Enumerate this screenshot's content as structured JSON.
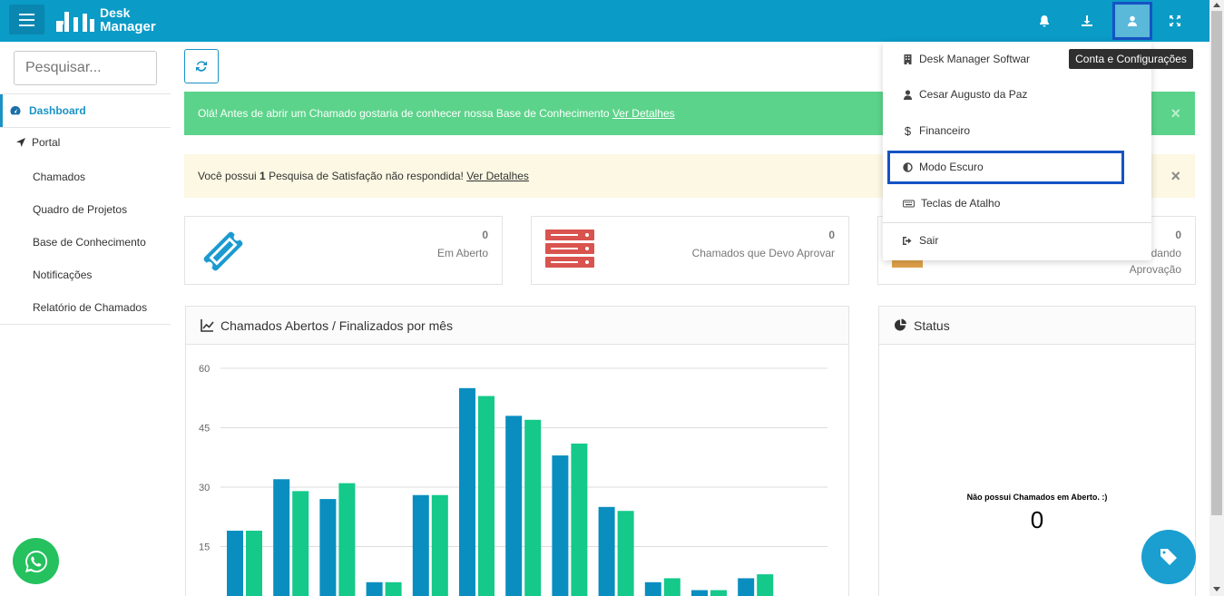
{
  "app": {
    "logo_line1": "Desk",
    "logo_line2": "Manager",
    "brand_color": "#0a9bc7"
  },
  "topbar": {
    "icons": [
      "bell-icon",
      "download-icon",
      "user-icon",
      "expand-icon"
    ]
  },
  "tooltip": "Conta e Configurações",
  "sidebar": {
    "search_placeholder": "Pesquisar...",
    "dashboard_label": "Dashboard",
    "portal_label": "Portal",
    "items": [
      {
        "label": "Chamados"
      },
      {
        "label": "Quadro de Projetos"
      },
      {
        "label": "Base de Conhecimento"
      },
      {
        "label": "Notificações"
      },
      {
        "label": "Relatório de Chamados"
      }
    ]
  },
  "alerts": {
    "green_text": "Olá! Antes de abrir um Chamado gostaria de conhecer nossa Base de Conhecimento ",
    "green_link": "Ver Detalhes",
    "yellow_prefix": "Você possui ",
    "yellow_count": "1",
    "yellow_suffix": " Pesquisa de Satisfação não respondida! ",
    "yellow_link": "Ver Detalhes",
    "close": "×"
  },
  "stats": [
    {
      "value": "0",
      "label": "Em Aberto"
    },
    {
      "value": "0",
      "label": "Chamados que Devo Aprovar"
    },
    {
      "value": "0",
      "label_line1": "dando",
      "label_line2": "Aprovação"
    }
  ],
  "chart_panel_title": "Chamados Abertos / Finalizados por mês",
  "status_panel": {
    "title": "Status",
    "message": "Não possui Chamados em Aberto. :)",
    "count": "0"
  },
  "dropdown": {
    "items": [
      {
        "label": "Desk Manager Softwar",
        "icon": "building-icon"
      },
      {
        "label": "Cesar Augusto da Paz",
        "icon": "user-icon"
      },
      {
        "label": "Financeiro",
        "icon": "dollar-icon"
      },
      {
        "label": "Modo Escuro",
        "icon": "contrast-icon"
      },
      {
        "label": "Teclas de Atalho",
        "icon": "keyboard-icon"
      },
      {
        "label": "Sair",
        "icon": "sign-out-icon"
      }
    ]
  },
  "chart_data": {
    "type": "bar",
    "ylim": [
      0,
      60
    ],
    "yticks": [
      15,
      30,
      45,
      60
    ],
    "colors": [
      "#0a8ec0",
      "#14c98a"
    ],
    "series": [
      {
        "values": [
          19,
          32,
          27,
          6,
          28,
          55,
          48,
          38,
          25,
          6,
          4,
          7
        ]
      },
      {
        "values": [
          19,
          29,
          31,
          6,
          28,
          53,
          47,
          41,
          24,
          7,
          4,
          8
        ]
      }
    ]
  }
}
